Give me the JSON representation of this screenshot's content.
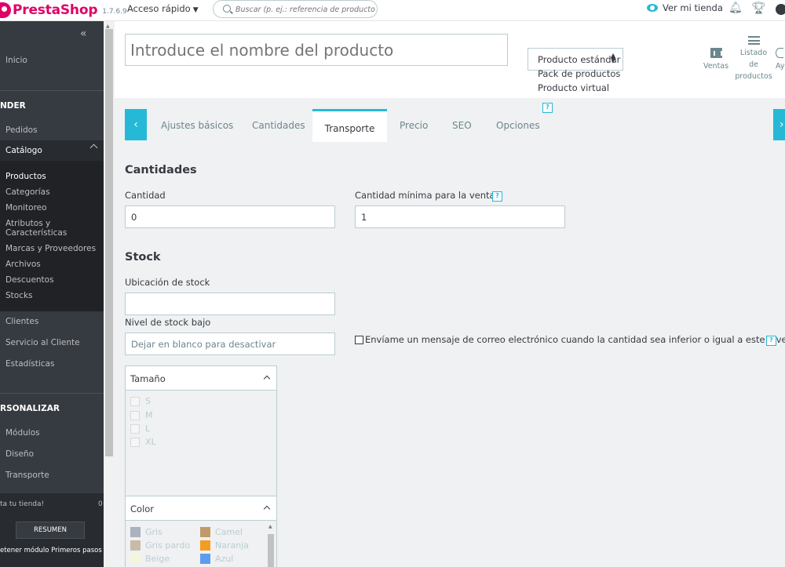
{
  "topbar": {
    "brand": "PrestaShop",
    "version": "1.7.6.9",
    "quick_access": "Acceso rápido",
    "search_placeholder": "Buscar (p. ej.: referencia de producto, no",
    "view_store": "Ver mi tienda"
  },
  "sidebar": {
    "collapse": "«",
    "home": "Inicio",
    "sell_section": "NDER",
    "orders": "Pedidos",
    "catalog": "Catálogo",
    "catalog_items": [
      "Productos",
      "Categorías",
      "Monitoreo",
      "Atributos y",
      "Características",
      "Marcas y Proveedores",
      "Archivos",
      "Descuentos",
      "Stocks"
    ],
    "customers": "Clientes",
    "customer_service": "Servicio al Cliente",
    "stats": "Estadísticas",
    "improve_section": "RSONALIZAR",
    "modules": "Módulos",
    "design": "Diseño",
    "shipping": "Transporte",
    "onboarding_text": "ta tu tienda!",
    "onboarding_pct": "0",
    "resumen": "RESUMEN",
    "stop_onboarding": "etener módulo Primeros pasos"
  },
  "header": {
    "name_placeholder": "Introduce el nombre del producto",
    "type_selected": "Producto estándar",
    "type_options": [
      "Pack de productos",
      "Producto virtual"
    ],
    "help": "?",
    "tools": [
      {
        "label": "Ventas",
        "icon": "bar-chart-icon"
      },
      {
        "label": "Listado de productos",
        "label_lines": [
          "Listado",
          "de",
          "productos"
        ],
        "icon": "list-icon"
      },
      {
        "label": "Ay"
      }
    ]
  },
  "tabs": [
    "Ajustes básicos",
    "Cantidades",
    "Transporte",
    "Precio",
    "SEO",
    "Opciones"
  ],
  "active_tab": "Transporte",
  "quantities": {
    "title": "Cantidades",
    "qty_label": "Cantidad",
    "qty_value": "0",
    "min_label": "Cantidad mínima para la venta",
    "min_value": "1"
  },
  "stock": {
    "title": "Stock",
    "location_label": "Ubicación de stock",
    "location_value": "",
    "low_label": "Nivel de stock bajo",
    "low_placeholder": "Dejar en blanco para desactivar",
    "email_label": "Envíame un mensaje de correo electrónico cuando la cantidad sea inferior o igual a este nivel"
  },
  "attributes": {
    "size": {
      "title": "Tamaño",
      "options": [
        "S",
        "M",
        "L",
        "XL"
      ]
    },
    "color": {
      "title": "Color",
      "left": [
        {
          "name": "Gris",
          "color": "#aab2bd"
        },
        {
          "name": "Gris pardo",
          "color": "#c8bca8"
        },
        {
          "name": "Beige",
          "color": "#f5f5dc"
        }
      ],
      "right": [
        {
          "name": "Camel",
          "color": "#c19a6b"
        },
        {
          "name": "Naranja",
          "color": "#f39d23"
        },
        {
          "name": "Azul",
          "color": "#5d9cec"
        }
      ]
    }
  }
}
